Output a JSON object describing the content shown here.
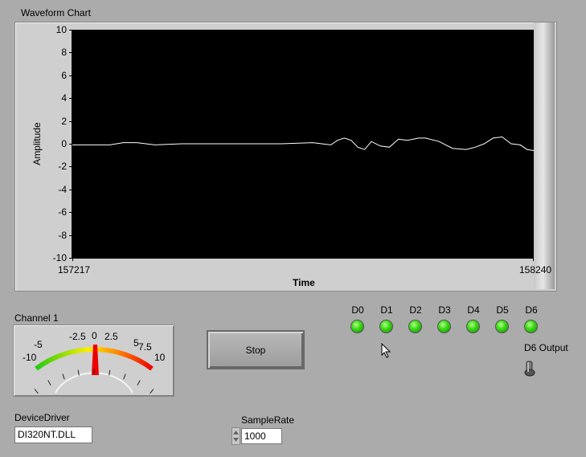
{
  "chart": {
    "title": "Waveform Chart",
    "ylabel": "Amplitude",
    "xlabel": "Time",
    "x_min_label": "157217",
    "x_max_label": "158240",
    "y_ticks": [
      "10",
      "8",
      "6",
      "4",
      "2",
      "0",
      "-2",
      "-4",
      "-6",
      "-8",
      "-10"
    ],
    "plot_bg": "#000000",
    "trace_color": "#ffffff"
  },
  "chart_data": {
    "type": "line",
    "title": "Waveform Chart",
    "xlabel": "Time",
    "ylabel": "Amplitude",
    "xlim": [
      157217,
      158240
    ],
    "ylim": [
      -10,
      10
    ],
    "x": [
      157217,
      157260,
      157300,
      157330,
      157360,
      157400,
      157460,
      157520,
      157600,
      157680,
      157750,
      157790,
      157805,
      157820,
      157835,
      157850,
      157865,
      157880,
      157900,
      157920,
      157940,
      157960,
      157985,
      158000,
      158030,
      158060,
      158090,
      158110,
      158130,
      158150,
      158170,
      158190,
      158210,
      158225,
      158240
    ],
    "values": [
      -0.1,
      -0.1,
      -0.1,
      0.1,
      0.1,
      -0.1,
      0.0,
      0.0,
      0.0,
      0.0,
      0.1,
      -0.1,
      0.3,
      0.5,
      0.3,
      -0.3,
      -0.5,
      0.2,
      -0.2,
      -0.3,
      0.4,
      0.3,
      0.5,
      0.5,
      0.2,
      -0.4,
      -0.5,
      -0.3,
      0.0,
      0.5,
      0.6,
      0.0,
      -0.1,
      -0.5,
      -0.6
    ]
  },
  "meter": {
    "label": "Channel 1",
    "ticks": [
      "-10",
      "-5",
      "-2.5",
      "0",
      "2.5",
      "5",
      "7.5",
      "10"
    ],
    "value": 0
  },
  "stop_button": {
    "label": "Stop"
  },
  "leds": [
    {
      "label": "D0",
      "on": true
    },
    {
      "label": "D1",
      "on": true
    },
    {
      "label": "D2",
      "on": true
    },
    {
      "label": "D3",
      "on": true
    },
    {
      "label": "D4",
      "on": true
    },
    {
      "label": "D5",
      "on": true
    },
    {
      "label": "D6",
      "on": true
    }
  ],
  "d6_output": {
    "label": "D6 Output"
  },
  "device_driver": {
    "label": "DeviceDriver",
    "value": "DI320NT.DLL"
  },
  "sample_rate": {
    "label": "SampleRate",
    "value": "1000"
  }
}
